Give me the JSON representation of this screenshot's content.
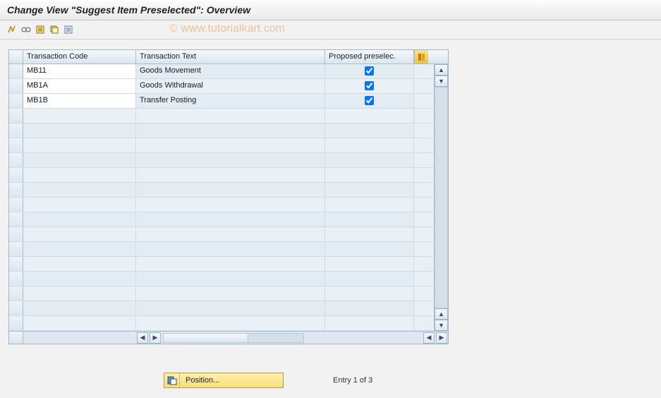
{
  "title": "Change View \"Suggest Item Preselected\": Overview",
  "watermark": "© www.tutorialkart.com",
  "toolbar": {
    "icons": [
      "toggle-icon",
      "glasses-icon",
      "new-entries-icon",
      "copy-icon",
      "delete-icon"
    ]
  },
  "table": {
    "columns": {
      "code": "Transaction Code",
      "text": "Transaction Text",
      "proposed": "Proposed preselec."
    },
    "rows": [
      {
        "code": "MB11",
        "text": "Goods Movement",
        "proposed": true
      },
      {
        "code": "MB1A",
        "text": "Goods Withdrawal",
        "proposed": true
      },
      {
        "code": "MB1B",
        "text": "Transfer Posting",
        "proposed": true
      }
    ],
    "empty_rows": 15
  },
  "footer": {
    "position_label": "Position...",
    "entry_text": "Entry 1 of 3"
  }
}
